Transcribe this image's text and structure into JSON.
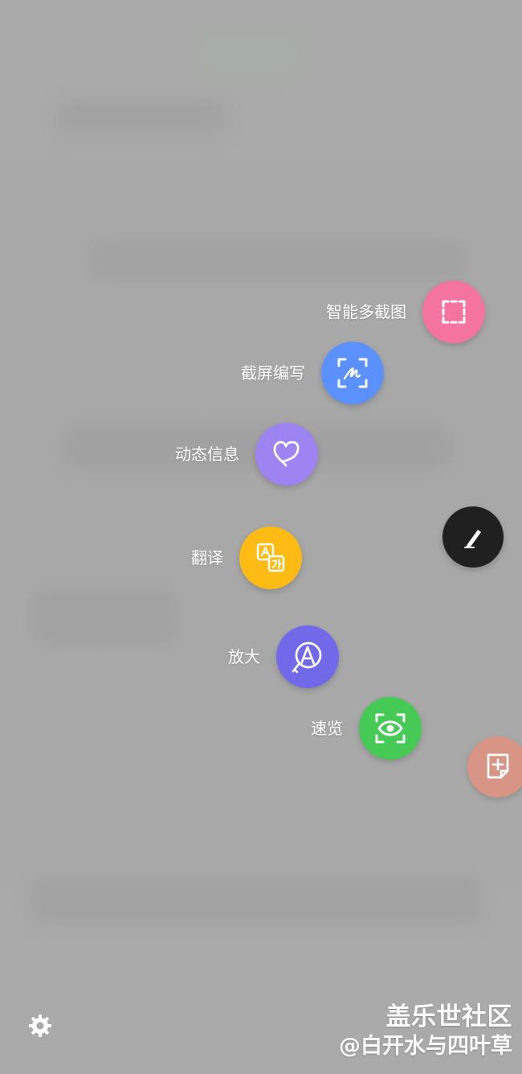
{
  "menu": {
    "items": [
      {
        "label": "智能多截图",
        "icon": "dashed-square-icon",
        "color": "#f5739f"
      },
      {
        "label": "截屏编写",
        "icon": "scribble-capture-icon",
        "color": "#5b90ff"
      },
      {
        "label": "动态信息",
        "icon": "heart-outline-icon",
        "color": "#9d84f2"
      },
      {
        "label": "翻译",
        "icon": "translate-icon",
        "color": "#fdbb14"
      },
      {
        "label": "放大",
        "icon": "magnify-a-icon",
        "color": "#7169ea"
      },
      {
        "label": "速览",
        "icon": "eye-capture-icon",
        "color": "#45ca55"
      }
    ]
  },
  "buttons": {
    "pen": {
      "icon": "pen-icon",
      "color": "#202020"
    },
    "note": {
      "icon": "note-add-icon",
      "color": "#d89585"
    },
    "settings": {
      "icon": "gear-icon"
    }
  },
  "watermark": {
    "brand": "盖乐世社区",
    "handle": "@白开水与四叶草"
  }
}
